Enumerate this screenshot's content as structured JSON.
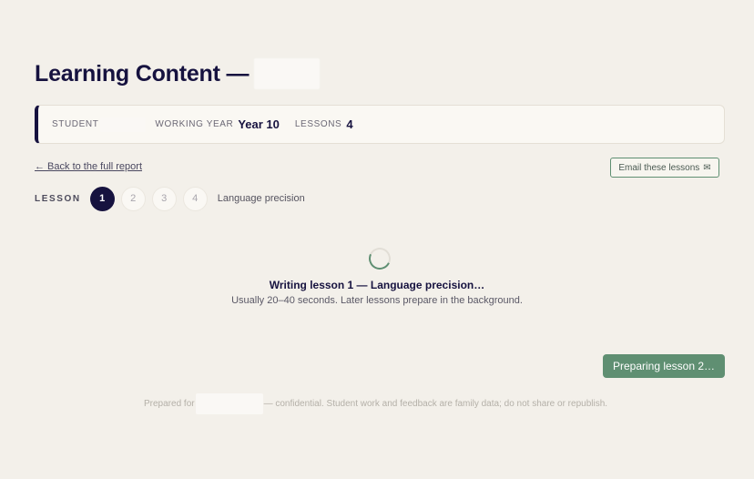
{
  "header": {
    "title": "Learning Content —"
  },
  "info": {
    "student_label": "STUDENT",
    "working_year_label": "WORKING YEAR",
    "working_year_value": "Year 10",
    "lessons_label": "LESSONS",
    "lessons_value": "4"
  },
  "nav": {
    "back_link": "← Back to the full report",
    "email_button": "Email these lessons",
    "email_icon": "envelope-icon"
  },
  "lessons": {
    "label": "LESSON",
    "steps": [
      "1",
      "2",
      "3",
      "4"
    ],
    "active_step": "1",
    "current_topic": "Language precision"
  },
  "status": {
    "title": "Writing lesson 1 — Language precision…",
    "subtitle": "Usually 20–40 seconds. Later lessons prepare in the background.",
    "prepare_button": "Preparing lesson 2…"
  },
  "footer": {
    "prefix": "Prepared for",
    "suffix": "— confidential. Student work and feedback are family data; do not share or republish."
  },
  "colors": {
    "background": "#f3f0ea",
    "navy": "#16123f",
    "accent_green": "#5f8f72"
  }
}
